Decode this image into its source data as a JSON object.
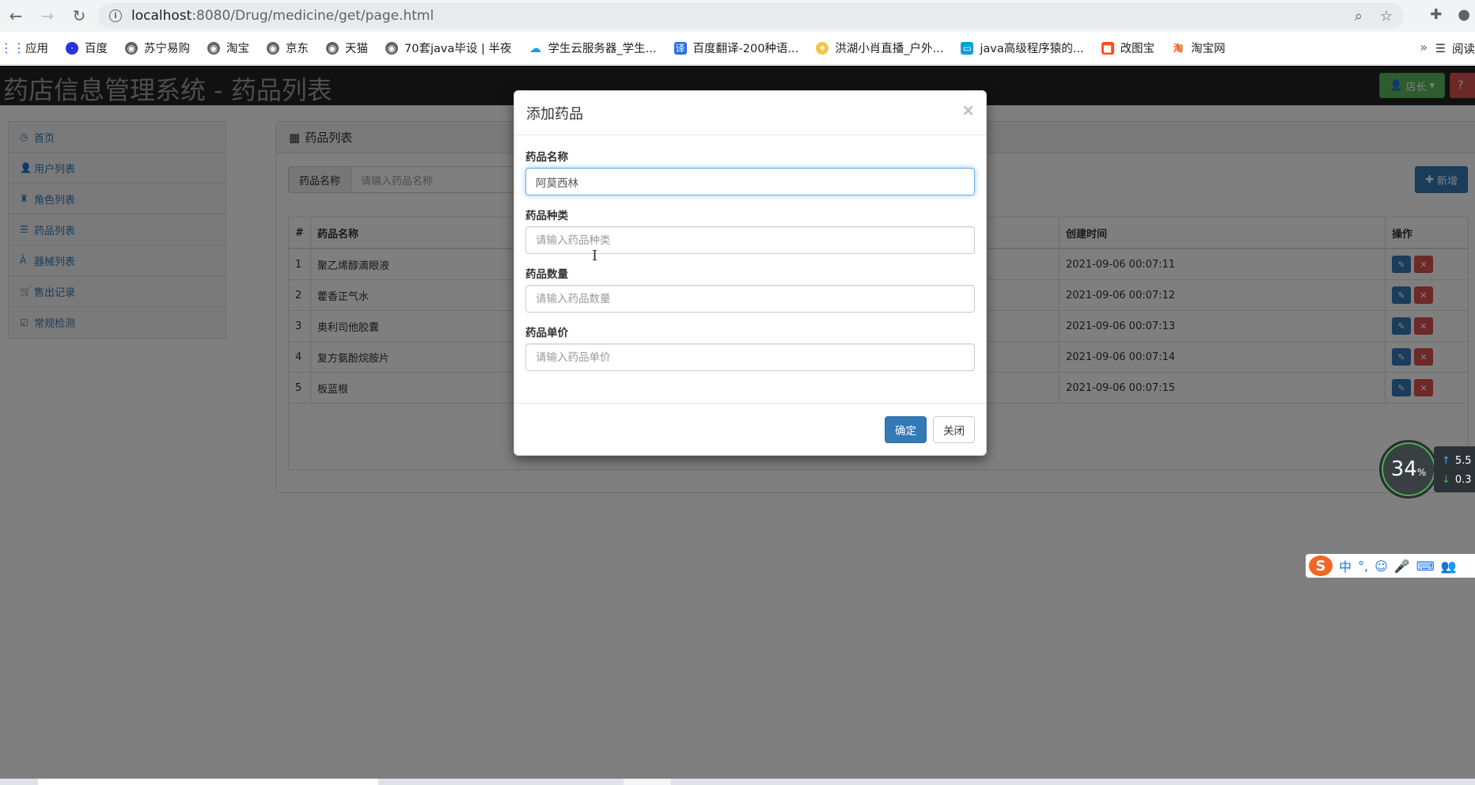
{
  "browser": {
    "url_host": "localhost",
    "url_path": ":8080/Drug/medicine/get/page.html",
    "bookmarks": [
      {
        "label": "应用",
        "icon": "apps-grid-icon"
      },
      {
        "label": "百度",
        "icon": "baidu-paw-icon"
      },
      {
        "label": "苏宁易购",
        "icon": "globe-icon"
      },
      {
        "label": "淘宝",
        "icon": "globe-icon"
      },
      {
        "label": "京东",
        "icon": "globe-icon"
      },
      {
        "label": "天猫",
        "icon": "globe-icon"
      },
      {
        "label": "70套java毕设 | 半夜",
        "icon": "globe-icon"
      },
      {
        "label": "学生云服务器_学生...",
        "icon": "cloud-icon"
      },
      {
        "label": "百度翻译-200种语...",
        "icon": "translate-icon"
      },
      {
        "label": "洪湖小肖直播_户外...",
        "icon": "bird-icon"
      },
      {
        "label": "java高级程序猿的...",
        "icon": "bilibili-icon"
      },
      {
        "label": "改图宝",
        "icon": "gaitubao-icon"
      },
      {
        "label": "淘宝网",
        "icon": "taobao-icon"
      }
    ],
    "more": "»",
    "reader": "阅读"
  },
  "app": {
    "title": "药店信息管理系统 - 药品列表",
    "role_button": "店长",
    "help_button": "?"
  },
  "sidebar": {
    "items": [
      {
        "label": "首页",
        "icon": "clock-icon"
      },
      {
        "label": "用户列表",
        "icon": "user-icon"
      },
      {
        "label": "角色列表",
        "icon": "role-icon"
      },
      {
        "label": "药品列表",
        "icon": "list-icon"
      },
      {
        "label": "器械列表",
        "icon": "instrument-icon"
      },
      {
        "label": "售出记录",
        "icon": "cart-icon"
      },
      {
        "label": "常规检测",
        "icon": "check-icon"
      }
    ]
  },
  "main": {
    "panel_title": "药品列表",
    "search_label": "药品名称",
    "search_placeholder": "请输入药品名称",
    "add_button": "新增",
    "table": {
      "headers": {
        "idx": "#",
        "name": "药品名称",
        "time": "创建时间",
        "op": "操作"
      },
      "rows": [
        {
          "idx": "1",
          "name": "聚乙烯醇滴眼液",
          "time": "2021-09-06 00:07:11"
        },
        {
          "idx": "2",
          "name": "藿香正气水",
          "time": "2021-09-06 00:07:12"
        },
        {
          "idx": "3",
          "name": "奥利司他胶囊",
          "time": "2021-09-06 00:07:13"
        },
        {
          "idx": "4",
          "name": "复方氨酚烷胺片",
          "time": "2021-09-06 00:07:14"
        },
        {
          "idx": "5",
          "name": "板蓝根",
          "time": "2021-09-06 00:07:15"
        }
      ]
    }
  },
  "modal": {
    "title": "添加药品",
    "close": "×",
    "fields": {
      "name": {
        "label": "药品名称",
        "value": "阿莫西林",
        "placeholder": ""
      },
      "type": {
        "label": "药品种类",
        "value": "",
        "placeholder": "请输入药品种类"
      },
      "count": {
        "label": "药品数量",
        "value": "",
        "placeholder": "请输入药品数量"
      },
      "price": {
        "label": "药品单价",
        "value": "",
        "placeholder": "请输入药品单价"
      }
    },
    "ok": "确定",
    "cancel": "关闭"
  },
  "widgets": {
    "speed_percent": "34",
    "speed_unit": "%",
    "upload": "5.5",
    "download": "0.3",
    "ime_lang": "中"
  },
  "colors": {
    "primary": "#337ab7",
    "danger": "#d9534f",
    "success": "#5cb85c",
    "header_bg": "#222222"
  }
}
